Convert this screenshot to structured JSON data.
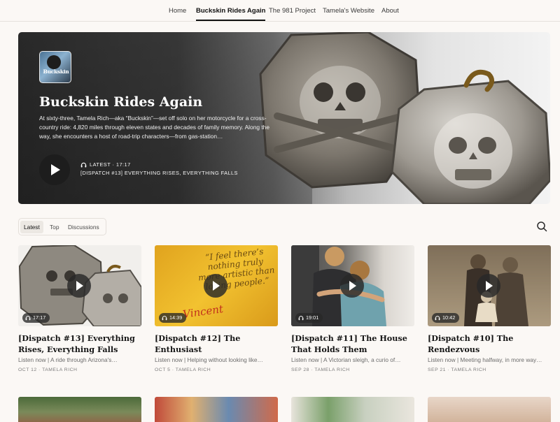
{
  "nav": {
    "items": [
      {
        "label": "Home"
      },
      {
        "label": "Buckskin Rides Again"
      },
      {
        "label": "The 981 Project"
      },
      {
        "label": "Tamela's Website"
      },
      {
        "label": "About"
      }
    ]
  },
  "hero": {
    "logo_text": "Buckskin",
    "title": "Buckskin Rides Again",
    "description": "At sixty-three, Tamela Rich—aka “Buckskin”—set off solo on her motorcycle for a cross-country ride: 4,820 miles through eleven states and decades of family memory. Along the way, she encounters a host of road-trip characters—from gas-station…",
    "latest_label": "LATEST · 17:17",
    "latest_title": "[DISPATCH #13] EVERYTHING RISES, EVERYTHING FALLS"
  },
  "tabs": [
    {
      "label": "Latest"
    },
    {
      "label": "Top"
    },
    {
      "label": "Discussions"
    }
  ],
  "posts": [
    {
      "title": "[Dispatch #13] Everything Rises, Everything Falls",
      "subtitle": "Listen now | A ride through Arizona's…",
      "meta": "OCT 12 · TAMELA RICH",
      "duration": "17:17"
    },
    {
      "title": "[Dispatch #12] The Enthusiast",
      "subtitle": "Listen now | Helping without looking like…",
      "meta": "OCT 5 · TAMELA RICH",
      "duration": "14:39"
    },
    {
      "title": "[Dispatch #11] The House That Holds Them",
      "subtitle": "Listen now | A Victorian sleigh, a curio of…",
      "meta": "SEP 28 · TAMELA RICH",
      "duration": "19:01"
    },
    {
      "title": "[Dispatch #10] The Rendezvous",
      "subtitle": "Listen now | Meeting halfway, in more way…",
      "meta": "SEP 21 · TAMELA RICH",
      "duration": "10:42"
    }
  ],
  "thumb_text": {
    "card2": "“I feel there’s nothing truly more artistic than loving people.”",
    "card2_sig": "Vincent"
  },
  "icons": {
    "play": "play-icon",
    "headphones": "headphones-icon",
    "search": "search-icon"
  },
  "colors": {
    "background": "#fbf8f5",
    "text": "#1e1e1e",
    "play_button": "#1d1d1d"
  }
}
